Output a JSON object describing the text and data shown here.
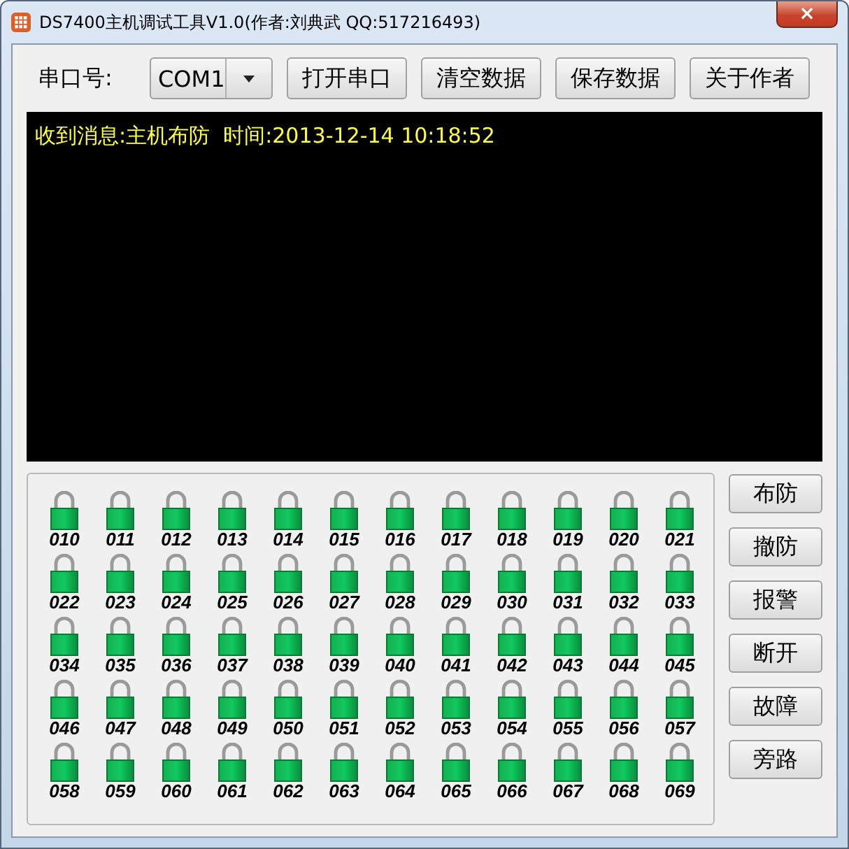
{
  "window": {
    "title": "DS7400主机调试工具V1.0(作者:刘典武 QQ:517216493)",
    "close": "×"
  },
  "toolbar": {
    "port_label": "串口号:",
    "port_value": "COM1",
    "buttons": [
      "打开串口",
      "清空数据",
      "保存数据",
      "关于作者"
    ]
  },
  "console": {
    "lines": [
      "收到消息:主机布防  时间:2013-12-14 10:18:52"
    ]
  },
  "zones": [
    "010",
    "011",
    "012",
    "013",
    "014",
    "015",
    "016",
    "017",
    "018",
    "019",
    "020",
    "021",
    "022",
    "023",
    "024",
    "025",
    "026",
    "027",
    "028",
    "029",
    "030",
    "031",
    "032",
    "033",
    "034",
    "035",
    "036",
    "037",
    "038",
    "039",
    "040",
    "041",
    "042",
    "043",
    "044",
    "045",
    "046",
    "047",
    "048",
    "049",
    "050",
    "051",
    "052",
    "053",
    "054",
    "055",
    "056",
    "057",
    "058",
    "059",
    "060",
    "061",
    "062",
    "063",
    "064",
    "065",
    "066",
    "067",
    "068",
    "069"
  ],
  "actions": [
    "布防",
    "撤防",
    "报警",
    "断开",
    "故障",
    "旁路"
  ]
}
